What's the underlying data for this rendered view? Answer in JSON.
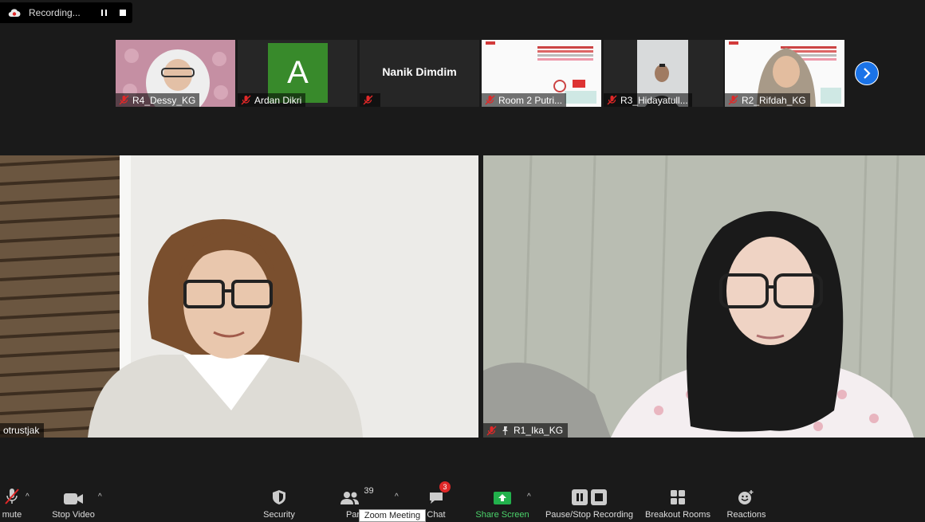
{
  "recording": {
    "label": "Recording..."
  },
  "thumbnails": [
    {
      "name": "R4_Dessy_KG"
    },
    {
      "name": "Ardan Dikri",
      "avatar_letter": "A",
      "avatar_color": "#388a2b"
    },
    {
      "name": "Nanik Dimdim"
    },
    {
      "name": "Room 2 Putri..."
    },
    {
      "name": "R3_Hidayatull..."
    },
    {
      "name": "R2_Rifdah_KG"
    }
  ],
  "main_videos": [
    {
      "name": "otrustjak"
    },
    {
      "name": "R1_Ika_KG"
    }
  ],
  "toolbar": {
    "unmute": "mute",
    "stop_video": "Stop Video",
    "security": "Security",
    "participants": "Partic",
    "participants_count": "39",
    "chat": "Chat",
    "chat_badge": "3",
    "share_screen": "Share Screen",
    "recording": "Pause/Stop Recording",
    "breakout": "Breakout Rooms",
    "reactions": "Reactions",
    "tooltip": "Zoom Meeting"
  },
  "colors": {
    "accent": "#1a73e8",
    "share_green": "#22b14c",
    "muted_red": "#e02828"
  }
}
